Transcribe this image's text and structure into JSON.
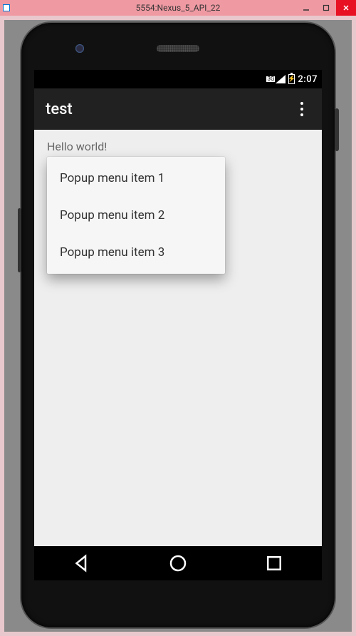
{
  "host": {
    "title": "5554:Nexus_5_API_22"
  },
  "status": {
    "network_label": "3G",
    "time": "2:07"
  },
  "app": {
    "title": "test",
    "hello_text": "Hello world!"
  },
  "popup": {
    "items": [
      {
        "label": "Popup menu item 1"
      },
      {
        "label": "Popup menu item 2"
      },
      {
        "label": "Popup menu item 3"
      }
    ]
  }
}
